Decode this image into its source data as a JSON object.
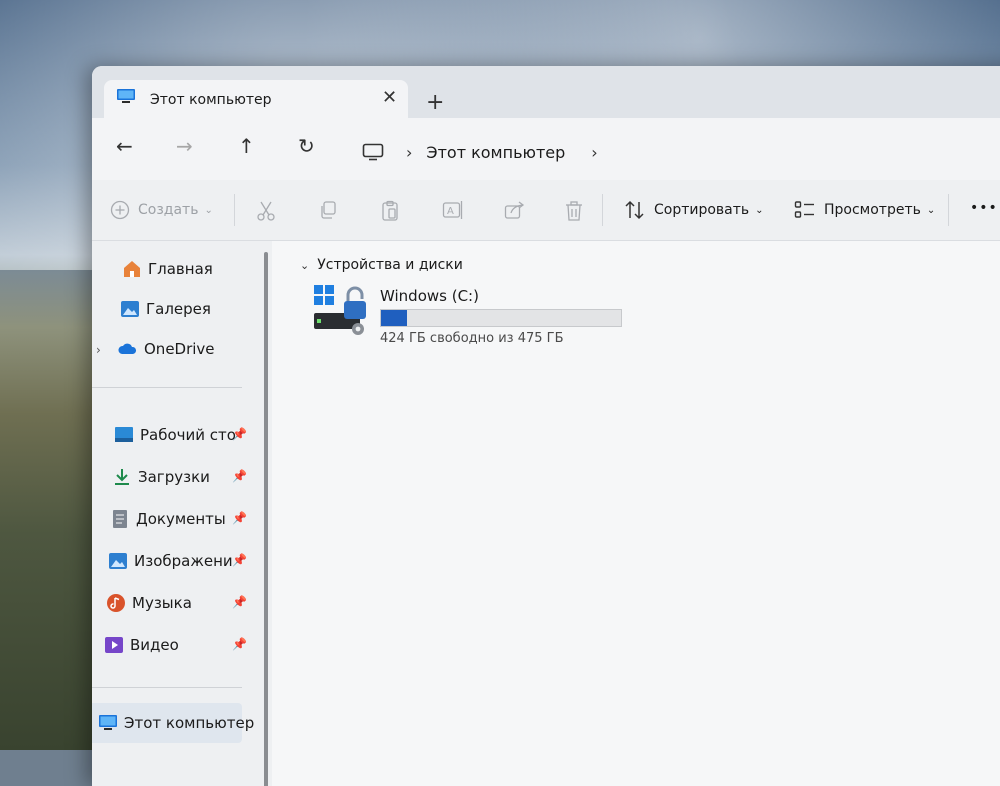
{
  "window": {
    "tab_title": "Этот компьютер",
    "close_tab_glyph": "✕",
    "new_tab_glyph": "+"
  },
  "nav": {
    "back_glyph": "←",
    "forward_glyph": "→",
    "up_glyph": "↑",
    "refresh_glyph": "↻",
    "breadcrumb_sep": "›",
    "breadcrumb": [
      "Этот компьютер"
    ],
    "breadcrumb_trailing": "›"
  },
  "toolbar": {
    "create_label": "Создать",
    "sort_label": "Сортировать",
    "view_label": "Просмотреть",
    "more_glyph": "•••",
    "caret_glyph": "⌄",
    "icons": [
      "cut-icon",
      "copy-icon",
      "paste-icon",
      "rename-icon",
      "share-icon",
      "delete-icon"
    ]
  },
  "sidebar": {
    "home": "Главная",
    "gallery": "Галерея",
    "onedrive": "OneDrive",
    "expander_glyph": "›",
    "pin_glyph": "📌",
    "pinned": [
      {
        "label": "Рабочий сто",
        "icon": "desktop-icon"
      },
      {
        "label": "Загрузки",
        "icon": "downloads-icon"
      },
      {
        "label": "Документы",
        "icon": "documents-icon"
      },
      {
        "label": "Изображени",
        "icon": "pictures-icon"
      },
      {
        "label": "Музыка",
        "icon": "music-icon"
      },
      {
        "label": "Видео",
        "icon": "video-icon"
      }
    ],
    "this_pc": "Этот компьютер"
  },
  "content": {
    "group_header": "Устройства и диски",
    "group_chevron": "⌄",
    "drive": {
      "name": "Windows (C:)",
      "free_text": "424 ГБ свободно из 475 ГБ",
      "used_fraction": 0.107
    }
  },
  "colors": {
    "accent": "#1f5fbf",
    "onedrive": "#1a73d9",
    "folder_blue": "#2d7fd0"
  }
}
